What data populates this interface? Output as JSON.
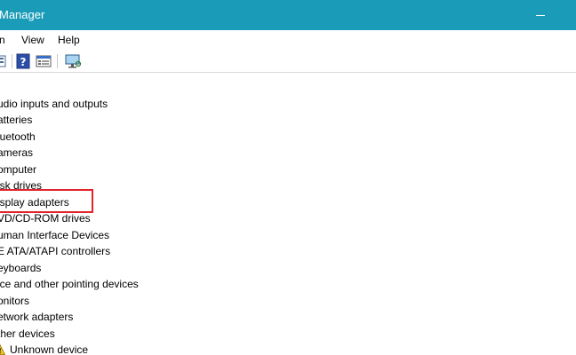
{
  "window": {
    "title": "Manager"
  },
  "menu": {
    "items": [
      "n",
      "View",
      "Help"
    ]
  },
  "toolbar": {
    "icons": [
      "view-icon",
      "help-icon",
      "properties-icon",
      "scan-hardware-icon"
    ]
  },
  "tree": {
    "categories": [
      "udio inputs and outputs",
      "atteries",
      "luetooth",
      "ameras",
      "omputer",
      "isk drives",
      "isplay adapters",
      "VD/CD-ROM drives",
      "uman Interface Devices",
      "E ATA/ATAPI controllers",
      "eyboards",
      "ice and other pointing devices",
      "onitors",
      "etwork adapters",
      "ther devices"
    ],
    "child_item": "Unknown device"
  },
  "highlight": {
    "target": "isplay adapters",
    "color": "#e2232a"
  },
  "colors": {
    "titlebar": "#1a9cb8"
  }
}
